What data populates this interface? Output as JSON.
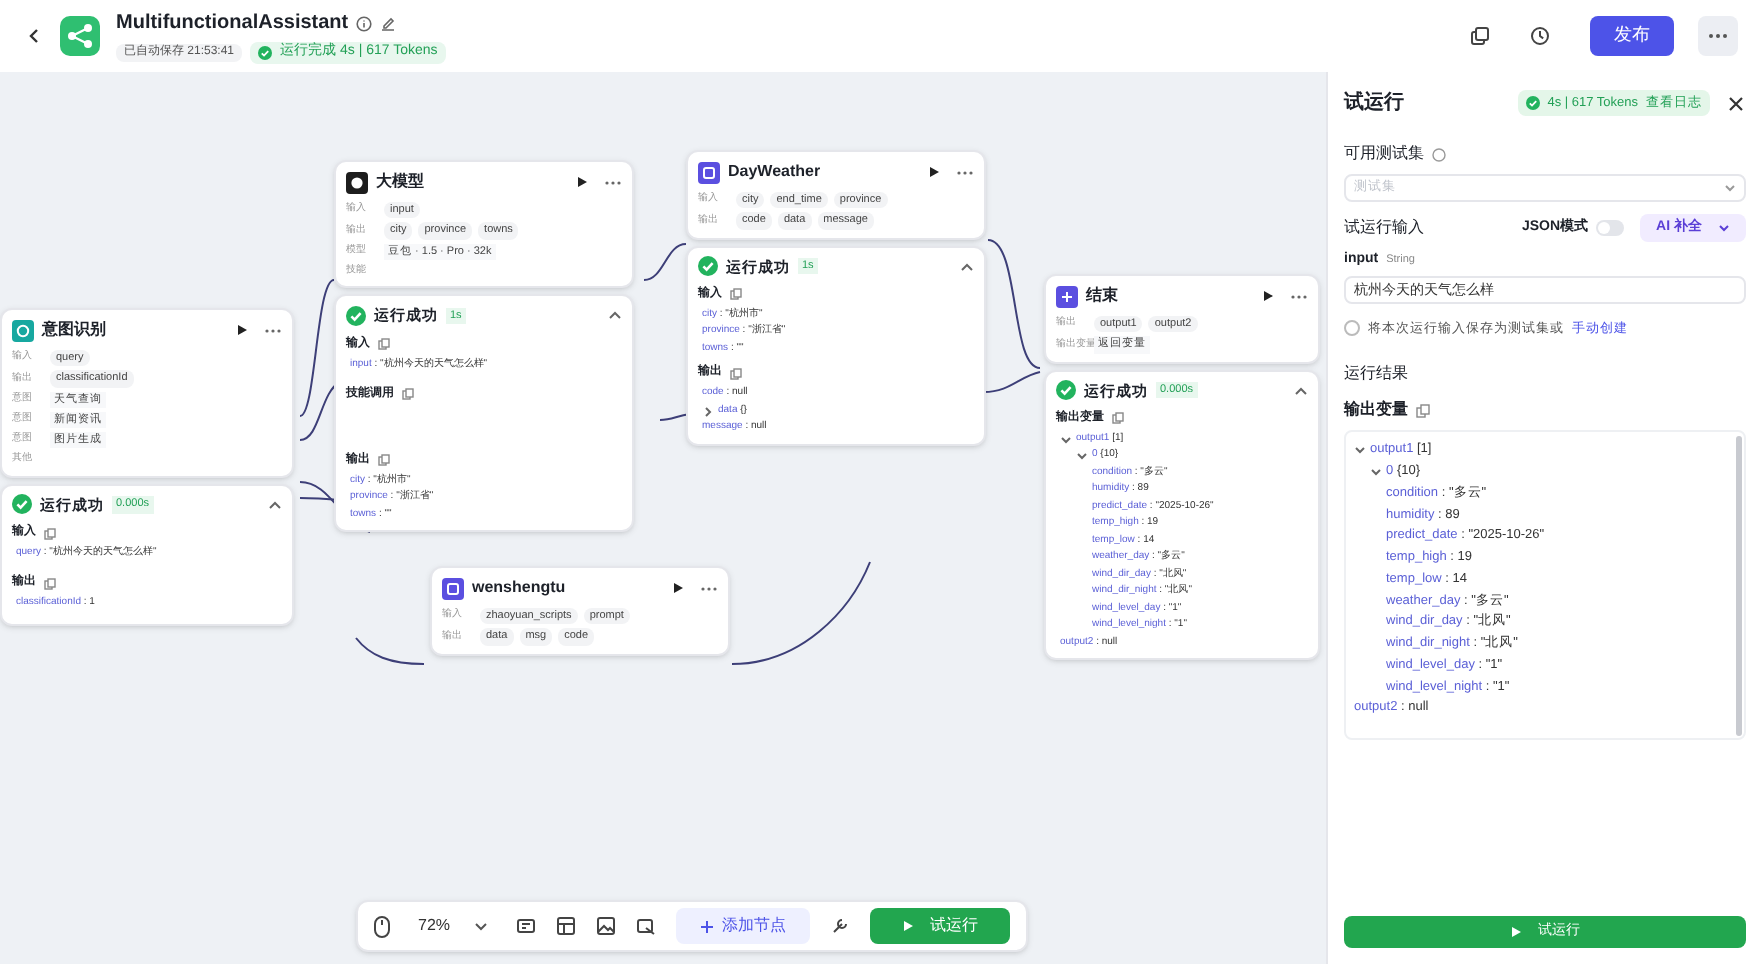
{
  "top_bar": {
    "title": "MultifunctionalAssistant",
    "autosave": "已自动保存 21:53:41",
    "run_status": "运行完成 4s | 617 Tokens",
    "publish_button": "发布"
  },
  "nodes": [
    {
      "kind": "intent",
      "title": "意图识别",
      "rows": [
        {
          "label": "输入",
          "tags": [
            "query"
          ]
        },
        {
          "label": "输出",
          "tags": [
            "classificationId"
          ]
        },
        {
          "label": "意图",
          "text": "天气查询"
        },
        {
          "label": "意图",
          "text": "新闻资讯"
        },
        {
          "label": "意图",
          "text": "图片生成"
        },
        {
          "label": "其他"
        }
      ],
      "result": {
        "status": "运行成功",
        "duration": "0.000s",
        "sections": [
          {
            "heading": "输入",
            "entries": [
              {
                "key": "query",
                "value": ": \"杭州今天的天气怎么样\""
              }
            ]
          },
          {
            "heading": "输出",
            "entries": [
              {
                "key": "classificationId",
                "value": ": 1"
              }
            ]
          }
        ]
      }
    },
    {
      "kind": "llm",
      "title": "大模型",
      "rows": [
        {
          "label": "输入",
          "tags": [
            "input"
          ]
        },
        {
          "label": "输出",
          "tags": [
            "city",
            "province",
            "towns"
          ]
        },
        {
          "label": "模型",
          "text": "豆包 · 1.5 · Pro · 32k"
        },
        {
          "label": "技能"
        }
      ],
      "result": {
        "status": "运行成功",
        "duration": "1s",
        "sections": [
          {
            "heading": "输入",
            "entries": [
              {
                "key": "input",
                "value": ": \"杭州今天的天气怎么样\""
              }
            ]
          },
          {
            "heading": "技能调用"
          },
          {
            "heading": "输出",
            "entries": [
              {
                "key": "city",
                "value": ": \"杭州市\""
              },
              {
                "key": "province",
                "value": ": \"浙江省\""
              },
              {
                "key": "towns",
                "value": ": \"\""
              }
            ]
          }
        ]
      }
    },
    {
      "kind": "plugin",
      "title": "DayWeather",
      "rows": [
        {
          "label": "输入",
          "tags": [
            "city",
            "end_time",
            "province"
          ]
        },
        {
          "label": "输出",
          "tags": [
            "code",
            "data",
            "message"
          ]
        }
      ],
      "result": {
        "status": "运行成功",
        "duration": "1s",
        "sections": [
          {
            "heading": "输入",
            "entries": [
              {
                "key": "city",
                "value": ": \"杭州市\""
              },
              {
                "key": "province",
                "value": ": \"浙江省\""
              },
              {
                "key": "towns",
                "value": ": \"\""
              }
            ]
          },
          {
            "heading": "输出",
            "entries": [
              {
                "key": "code",
                "value": ": null"
              },
              {
                "key": "data",
                "value": "{}",
                "expanded": false
              },
              {
                "key": "message",
                "value": ": null"
              }
            ]
          }
        ]
      }
    },
    {
      "kind": "plugin",
      "title": "wenshengtu",
      "rows": [
        {
          "label": "输入",
          "tags": [
            "zhaoyuan_scripts",
            "prompt"
          ]
        },
        {
          "label": "输出",
          "tags": [
            "data",
            "msg",
            "code"
          ]
        }
      ]
    },
    {
      "kind": "end",
      "title": "结束",
      "rows": [
        {
          "label": "输出",
          "tags": [
            "output1",
            "output2"
          ]
        },
        {
          "label": "输出变量",
          "text": "返回变量"
        }
      ],
      "result": {
        "status": "运行成功",
        "duration": "0.000s",
        "sections": [
          {
            "heading": "输出变量",
            "entries": [
              {
                "key": "output1",
                "value": "[1]",
                "expanded": true,
                "children": [
                  {
                    "key": "0",
                    "value": "{10}",
                    "expanded": true,
                    "children": [
                      {
                        "key": "condition",
                        "value": ": \"多云\""
                      },
                      {
                        "key": "humidity",
                        "value": ": 89"
                      },
                      {
                        "key": "predict_date",
                        "value": ": \"2025-10-26\""
                      },
                      {
                        "key": "temp_high",
                        "value": ": 19"
                      },
                      {
                        "key": "temp_low",
                        "value": ": 14"
                      },
                      {
                        "key": "weather_day",
                        "value": ": \"多云\""
                      },
                      {
                        "key": "wind_dir_day",
                        "value": ": \"北风\""
                      },
                      {
                        "key": "wind_dir_night",
                        "value": ": \"北风\""
                      },
                      {
                        "key": "wind_level_day",
                        "value": ": \"1\""
                      },
                      {
                        "key": "wind_level_night",
                        "value": ": \"1\""
                      }
                    ]
                  }
                ]
              },
              {
                "key": "output2",
                "value": ": null"
              }
            ]
          }
        ]
      }
    }
  ],
  "toolbar": {
    "zoom": "72%",
    "add_node": "添加节点",
    "run_button": "试运行"
  },
  "panel": {
    "title": "试运行",
    "badge": "4s | 617 Tokens",
    "log_link": "查看日志",
    "testset_label": "可用测试集",
    "testset_placeholder": "测试集",
    "input_heading": "试运行输入",
    "json_mode_label": "JSON模式",
    "json_mode_on": false,
    "ai_button": "AI 补全",
    "field_name": "input",
    "field_type": "String",
    "field_value": "杭州今天的天气怎么样",
    "save_checked": false,
    "save_text": "将本次运行输入保存为测试集或",
    "save_link": "手动创建",
    "result_heading": "运行结果",
    "output_heading": "输出变量",
    "output": [
      {
        "key": "output1",
        "value": "[1]",
        "expanded": true,
        "children": [
          {
            "key": "0",
            "value": "{10}",
            "expanded": true,
            "children": [
              {
                "key": "condition",
                "value": ": \"多云\""
              },
              {
                "key": "humidity",
                "value": ": 89"
              },
              {
                "key": "predict_date",
                "value": ": \"2025-10-26\""
              },
              {
                "key": "temp_high",
                "value": ": 19"
              },
              {
                "key": "temp_low",
                "value": ": 14"
              },
              {
                "key": "weather_day",
                "value": ": \"多云\""
              },
              {
                "key": "wind_dir_day",
                "value": ": \"北风\""
              },
              {
                "key": "wind_dir_night",
                "value": ": \"北风\""
              },
              {
                "key": "wind_level_day",
                "value": ": \"1\""
              },
              {
                "key": "wind_level_night",
                "value": ": \"1\""
              }
            ]
          }
        ]
      },
      {
        "key": "output2",
        "value": ": null"
      }
    ],
    "run_button": "试运行"
  }
}
